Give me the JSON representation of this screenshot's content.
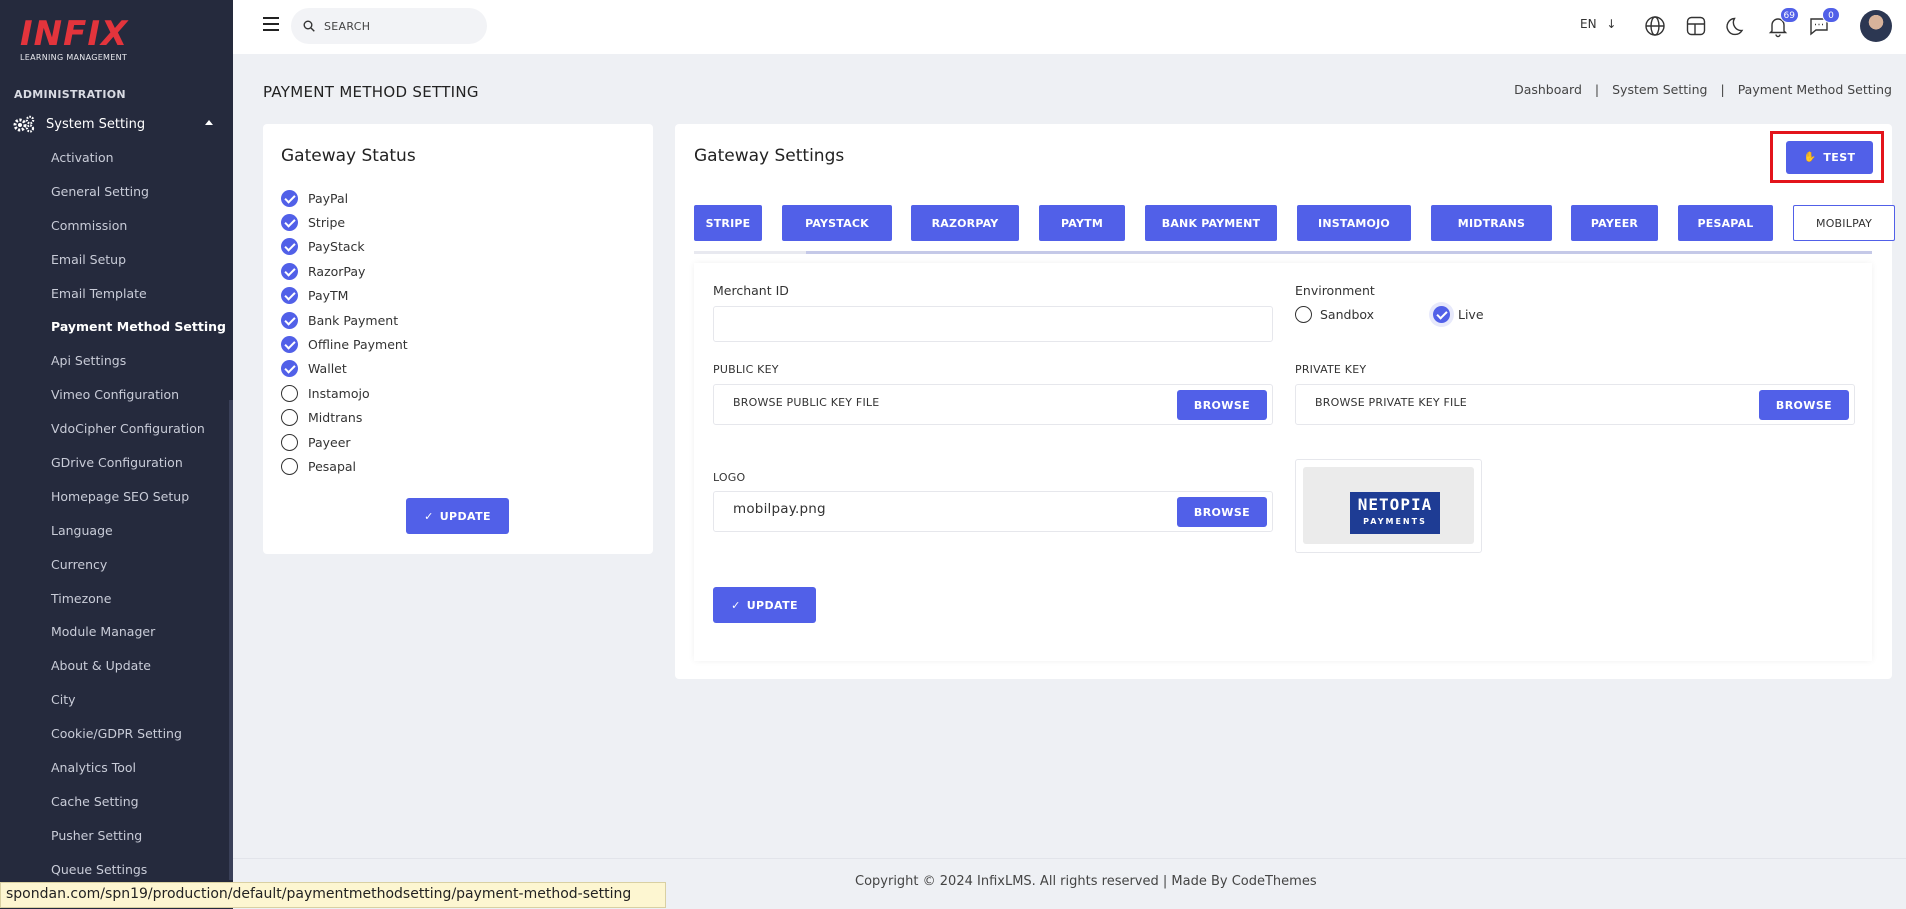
{
  "brand": {
    "name": "INFIX",
    "subtitle": "LEARNING MANAGEMENT"
  },
  "sidebar": {
    "section": "ADMINISTRATION",
    "group": "System Setting",
    "items": [
      {
        "label": "Activation"
      },
      {
        "label": "General Setting"
      },
      {
        "label": "Commission"
      },
      {
        "label": "Email Setup"
      },
      {
        "label": "Email Template"
      },
      {
        "label": "Payment Method Setting",
        "active": true
      },
      {
        "label": "Api Settings"
      },
      {
        "label": "Vimeo Configuration"
      },
      {
        "label": "VdoCipher Configuration"
      },
      {
        "label": "GDrive Configuration"
      },
      {
        "label": "Homepage SEO Setup"
      },
      {
        "label": "Language"
      },
      {
        "label": "Currency"
      },
      {
        "label": "Timezone"
      },
      {
        "label": "Module Manager"
      },
      {
        "label": "About & Update"
      },
      {
        "label": "City"
      },
      {
        "label": "Cookie/GDPR Setting"
      },
      {
        "label": "Analytics Tool"
      },
      {
        "label": "Cache Setting"
      },
      {
        "label": "Pusher Setting"
      },
      {
        "label": "Queue Settings"
      }
    ]
  },
  "topbar": {
    "search_placeholder": "SEARCH",
    "language": "EN",
    "notifications_count": "69",
    "messages_count": "0"
  },
  "page": {
    "title": "PAYMENT METHOD SETTING",
    "breadcrumb": [
      "Dashboard",
      "System Setting",
      "Payment Method Setting"
    ]
  },
  "gateway_status": {
    "title": "Gateway Status",
    "items": [
      {
        "label": "PayPal",
        "checked": true
      },
      {
        "label": "Stripe",
        "checked": true
      },
      {
        "label": "PayStack",
        "checked": true
      },
      {
        "label": "RazorPay",
        "checked": true
      },
      {
        "label": "PayTM",
        "checked": true
      },
      {
        "label": "Bank Payment",
        "checked": true
      },
      {
        "label": "Offline Payment",
        "checked": true
      },
      {
        "label": "Wallet",
        "checked": true
      },
      {
        "label": "Instamojo",
        "checked": false
      },
      {
        "label": "Midtrans",
        "checked": false
      },
      {
        "label": "Payeer",
        "checked": false
      },
      {
        "label": "Pesapal",
        "checked": false
      }
    ],
    "update_label": "UPDATE"
  },
  "gateway_settings": {
    "title": "Gateway Settings",
    "test_label": "TEST",
    "tabs": [
      "STRIPE",
      "PAYSTACK",
      "RAZORPAY",
      "PAYTM",
      "BANK PAYMENT",
      "INSTAMOJO",
      "MIDTRANS",
      "PAYEER",
      "PESAPAL",
      "MOBILPAY"
    ],
    "active_tab": "MOBILPAY",
    "merchant_id_label": "Merchant ID",
    "merchant_id_value": "",
    "environment_label": "Environment",
    "environment_options": [
      "Sandbox",
      "Live"
    ],
    "environment_selected": "Live",
    "public_key_label": "PUBLIC KEY",
    "public_key_placeholder": "BROWSE PUBLIC KEY FILE",
    "private_key_label": "PRIVATE KEY",
    "private_key_placeholder": "BROWSE PRIVATE KEY FILE",
    "browse_label": "BROWSE",
    "logo_label": "LOGO",
    "logo_file": "mobilpay.png",
    "logo_text_1": "NETOPIA",
    "logo_text_2": "PAYMENTS",
    "update_label": "UPDATE"
  },
  "footer": {
    "copyright": "Copyright © 2024 InfixLMS. All rights reserved | Made By CodeThemes"
  },
  "status_url": "spondan.com/spn19/production/default/paymentmethodsetting/payment-method-setting",
  "colors": {
    "accent": "#5160e8",
    "sidebar_bg": "#252a3d",
    "brand_red": "#e3343c",
    "highlight": "#e3141b"
  }
}
